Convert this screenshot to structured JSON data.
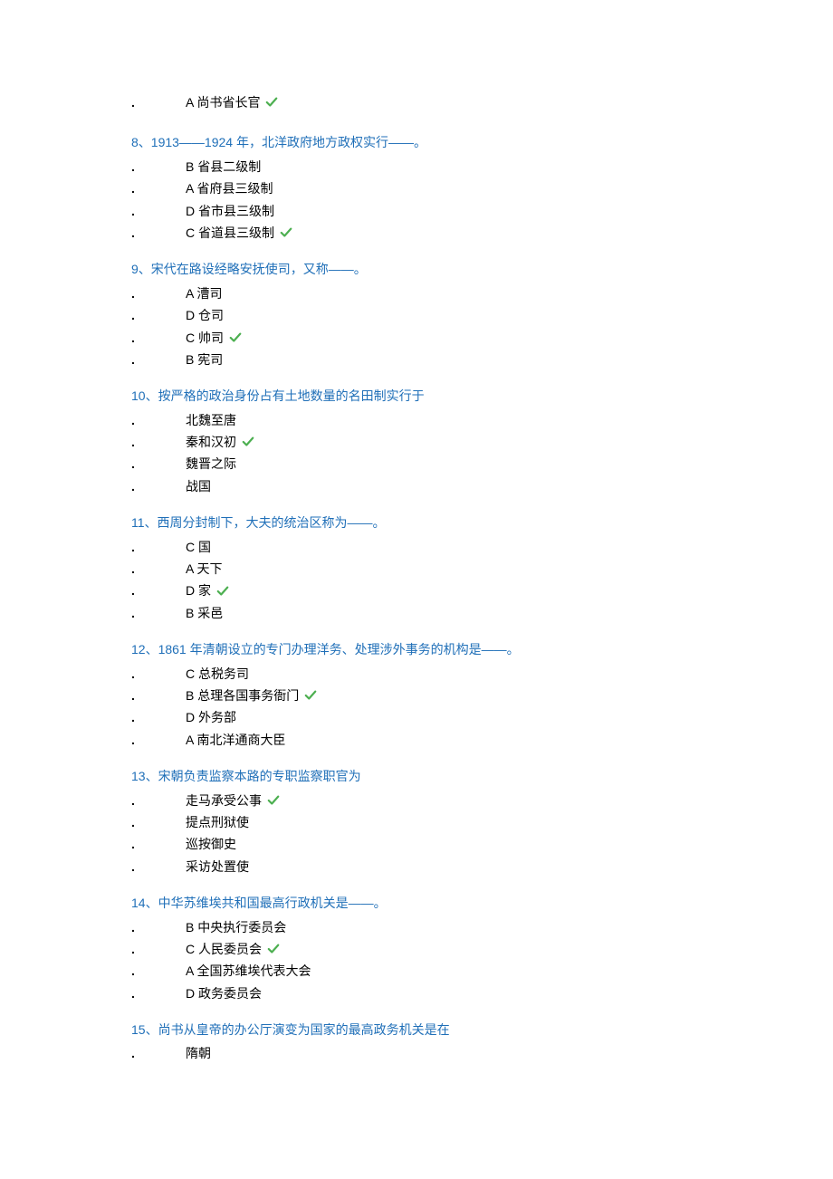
{
  "first_answer": {
    "text": "A 尚书省长官",
    "correct": true
  },
  "questions": [
    {
      "title": "8、1913——1924 年，北洋政府地方政权实行——。",
      "answers": [
        {
          "text": "B 省县二级制",
          "correct": false
        },
        {
          "text": "A 省府县三级制",
          "correct": false
        },
        {
          "text": "D 省市县三级制",
          "correct": false
        },
        {
          "text": "C 省道县三级制",
          "correct": true
        }
      ]
    },
    {
      "title": "9、宋代在路设经略安抚使司，又称——。",
      "answers": [
        {
          "text": "A 漕司",
          "correct": false
        },
        {
          "text": "D 仓司",
          "correct": false
        },
        {
          "text": "C 帅司",
          "correct": true
        },
        {
          "text": "B 宪司",
          "correct": false
        }
      ]
    },
    {
      "title": "10、按严格的政治身份占有土地数量的名田制实行于",
      "answers": [
        {
          "text": "北魏至唐",
          "correct": false
        },
        {
          "text": "秦和汉初",
          "correct": true
        },
        {
          "text": "魏晋之际",
          "correct": false
        },
        {
          "text": "战国",
          "correct": false
        }
      ]
    },
    {
      "title": "11、西周分封制下，大夫的统治区称为——。",
      "answers": [
        {
          "text": "C 国",
          "correct": false
        },
        {
          "text": "A 天下",
          "correct": false
        },
        {
          "text": "D 家",
          "correct": true
        },
        {
          "text": "B 采邑",
          "correct": false
        }
      ]
    },
    {
      "title": "12、1861 年清朝设立的专门办理洋务、处理涉外事务的机构是——。",
      "answers": [
        {
          "text": "C 总税务司",
          "correct": false
        },
        {
          "text": "B 总理各国事务衙门",
          "correct": true
        },
        {
          "text": "D 外务部",
          "correct": false
        },
        {
          "text": "A 南北洋通商大臣",
          "correct": false
        }
      ]
    },
    {
      "title": "13、宋朝负责监察本路的专职监察职官为",
      "answers": [
        {
          "text": "走马承受公事",
          "correct": true
        },
        {
          "text": "提点刑狱使",
          "correct": false
        },
        {
          "text": "巡按御史",
          "correct": false
        },
        {
          "text": "采访处置使",
          "correct": false
        }
      ]
    },
    {
      "title": "14、中华苏维埃共和国最高行政机关是——。",
      "answers": [
        {
          "text": "B 中央执行委员会",
          "correct": false
        },
        {
          "text": "C 人民委员会",
          "correct": true
        },
        {
          "text": "A 全国苏维埃代表大会",
          "correct": false
        },
        {
          "text": "D 政务委员会",
          "correct": false
        }
      ]
    },
    {
      "title": "15、尚书从皇帝的办公厅演变为国家的最高政务机关是在",
      "answers": [
        {
          "text": "隋朝",
          "correct": false
        }
      ]
    }
  ]
}
